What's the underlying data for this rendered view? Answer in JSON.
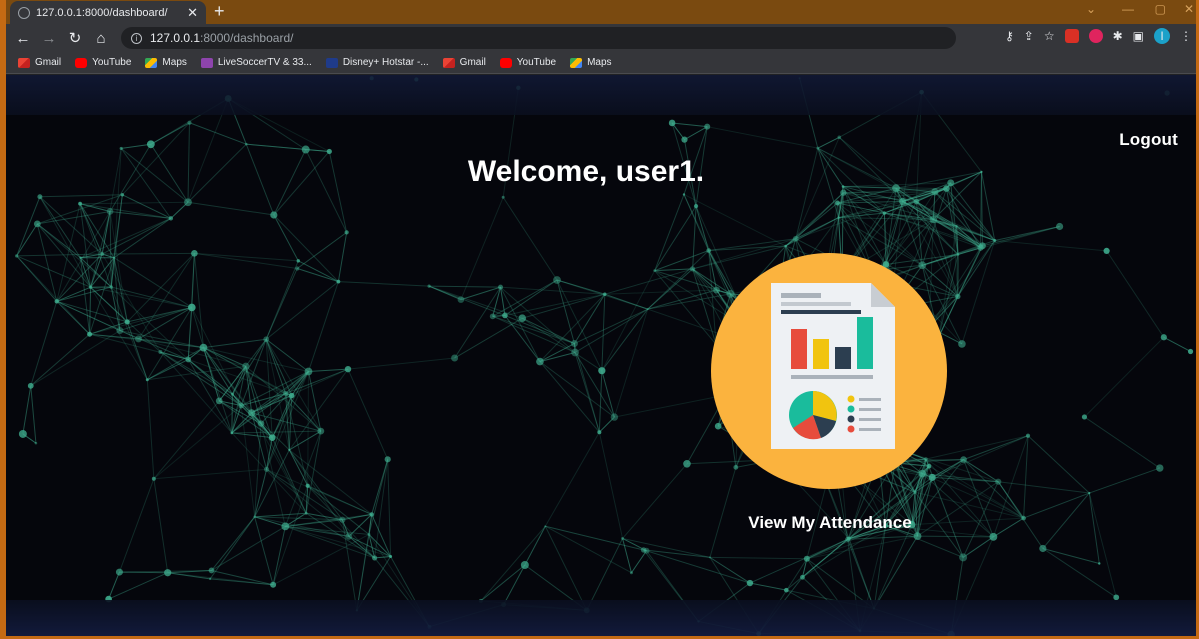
{
  "browser": {
    "tab_title": "127.0.0.1:8000/dashboard/",
    "url_host": "127.0.0.1",
    "url_path": ":8000/dashboard/",
    "bookmarks": [
      {
        "label": "Gmail",
        "icon": "gmail-icon"
      },
      {
        "label": "YouTube",
        "icon": "youtube-icon"
      },
      {
        "label": "Maps",
        "icon": "maps-icon"
      },
      {
        "label": "LiveSoccerTV & 33...",
        "icon": "livesoccer-icon"
      },
      {
        "label": "Disney+ Hotstar -...",
        "icon": "hotstar-icon"
      },
      {
        "label": "Gmail",
        "icon": "gmail-icon"
      },
      {
        "label": "YouTube",
        "icon": "youtube-icon"
      },
      {
        "label": "Maps",
        "icon": "maps-icon"
      }
    ],
    "profile_initial": "I"
  },
  "page": {
    "logout_label": "Logout",
    "welcome_text": "Welcome, user1.",
    "attendance_label": "View My Attendance"
  },
  "colors": {
    "accent_circle": "#fbb33e",
    "network_line": "#3fae8f"
  }
}
